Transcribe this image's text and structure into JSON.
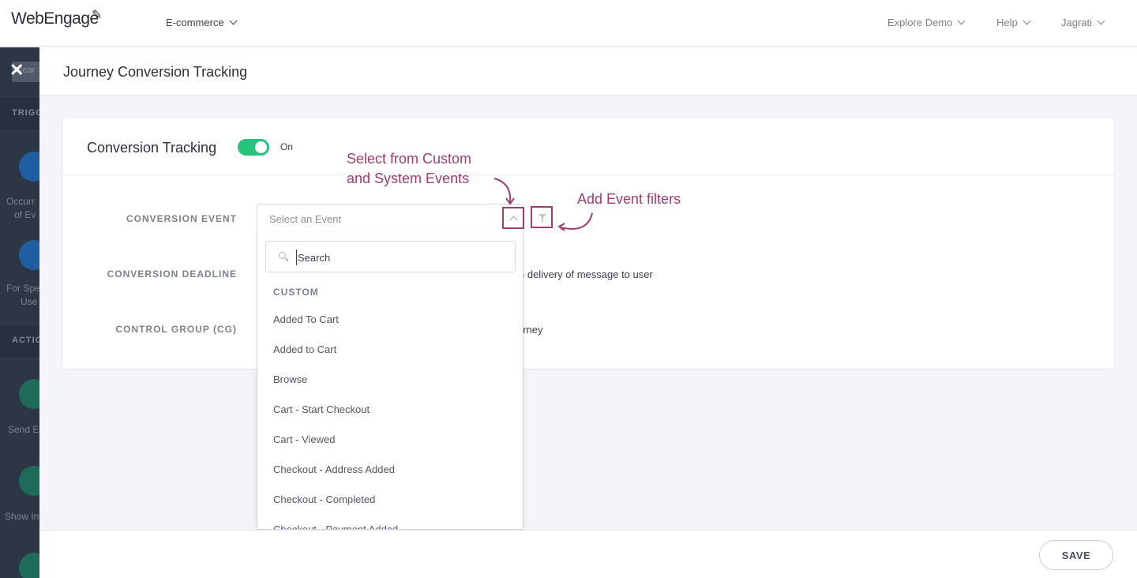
{
  "header": {
    "logo": "WebEngage",
    "project": "E-commerce",
    "nav": [
      "Explore Demo",
      "Help",
      "Jagrati"
    ]
  },
  "sidebar": {
    "close": "✕",
    "search_ghost": "Sear",
    "section1": "TRIGG",
    "item1_line1": "Occurr",
    "item1_line2": "of Ev",
    "item2_line1": "For Spe",
    "item2_line2": "Use",
    "section2": "ACTIO",
    "item3": "Send E",
    "item4": "Show In"
  },
  "panel": {
    "title": "Journey Conversion Tracking"
  },
  "card": {
    "title": "Conversion Tracking",
    "toggle_label": "On",
    "toggle_on": true,
    "fields": {
      "event_label": "CONVERSION EVENT",
      "deadline_label": "CONVERSION DEADLINE",
      "cg_label": "CONTROL GROUP (CG)",
      "deadline_text": "n delivery of message to user",
      "cg_text": "urney"
    },
    "select_placeholder": "Select an Event"
  },
  "dropdown": {
    "search_placeholder": "Search",
    "group": "CUSTOM",
    "options": [
      "Added To Cart",
      "Added to Cart",
      "Browse",
      "Cart - Start Checkout",
      "Cart - Viewed",
      "Checkout - Address Added",
      "Checkout - Completed",
      "Checkout - Payment Added"
    ]
  },
  "annotations": {
    "custom_line1": "Select from Custom",
    "custom_line2": "and System Events",
    "filters": "Add Event filters",
    "color": "#9e3d6e"
  },
  "footer": {
    "save": "SAVE"
  },
  "colors": {
    "toggle": "#27c27c",
    "sidebar": "#2c3645"
  }
}
